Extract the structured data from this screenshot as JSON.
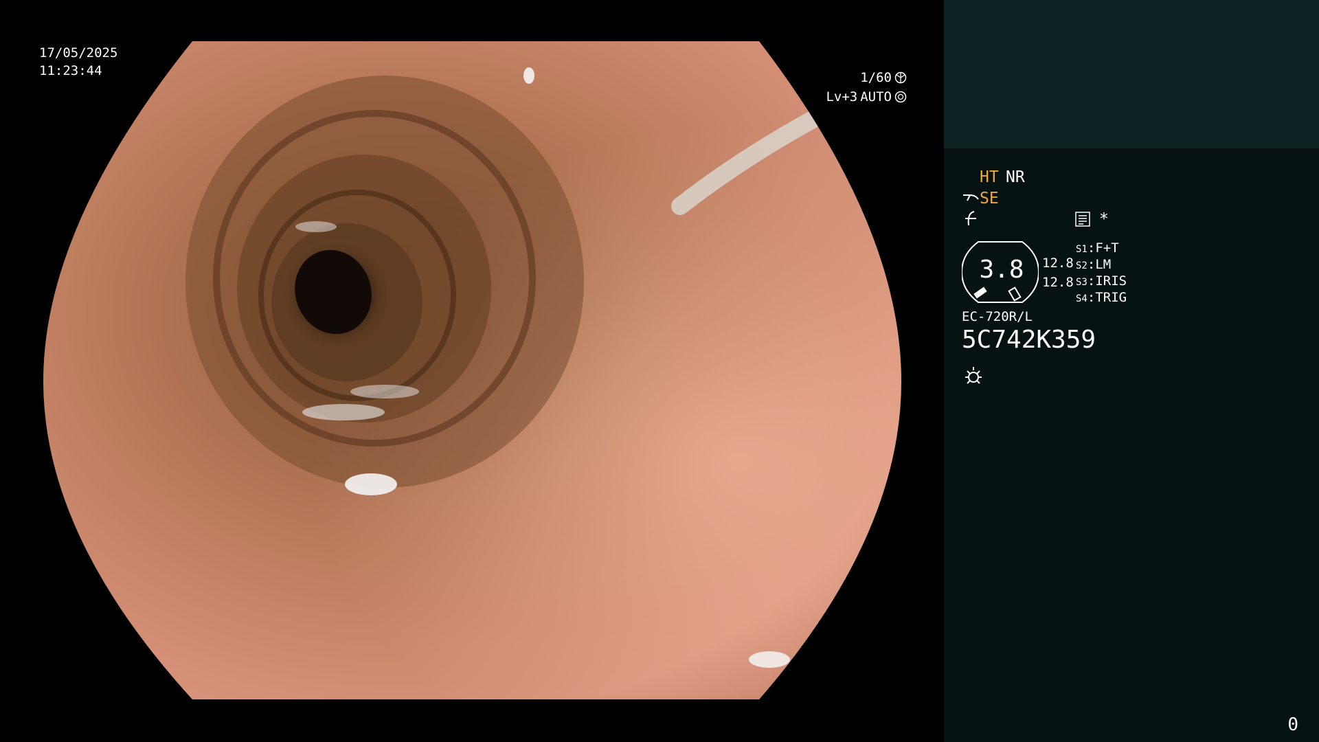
{
  "overlay": {
    "date": "17/05/2025",
    "time": "11:23:44",
    "shutter": "1/60",
    "iris_level": "Lv+3",
    "iris_mode": "AUTO"
  },
  "panel": {
    "enhance": "HT",
    "noise_reduction": "NR",
    "structure_mode": "SE",
    "star": "*",
    "gauge_value": "3.8",
    "gauge_side_1": "12.8",
    "gauge_side_2": "12.8",
    "switches": [
      {
        "key": "S1",
        "value": "F+T"
      },
      {
        "key": "S2",
        "value": "LM"
      },
      {
        "key": "S3",
        "value": "IRIS"
      },
      {
        "key": "S4",
        "value": "TRIG"
      }
    ],
    "scope_model": "EC-720R/L",
    "scope_serial": "5C742K359",
    "counter": "0"
  },
  "colors": {
    "panel_bg": "#071312",
    "panel_top_bg": "#0c2223",
    "accent": "#f2a93b"
  },
  "icons": [
    "shutter-icon",
    "iris-icon",
    "scope-tip-icon",
    "structure-icon",
    "menu-icon",
    "light-icon"
  ]
}
